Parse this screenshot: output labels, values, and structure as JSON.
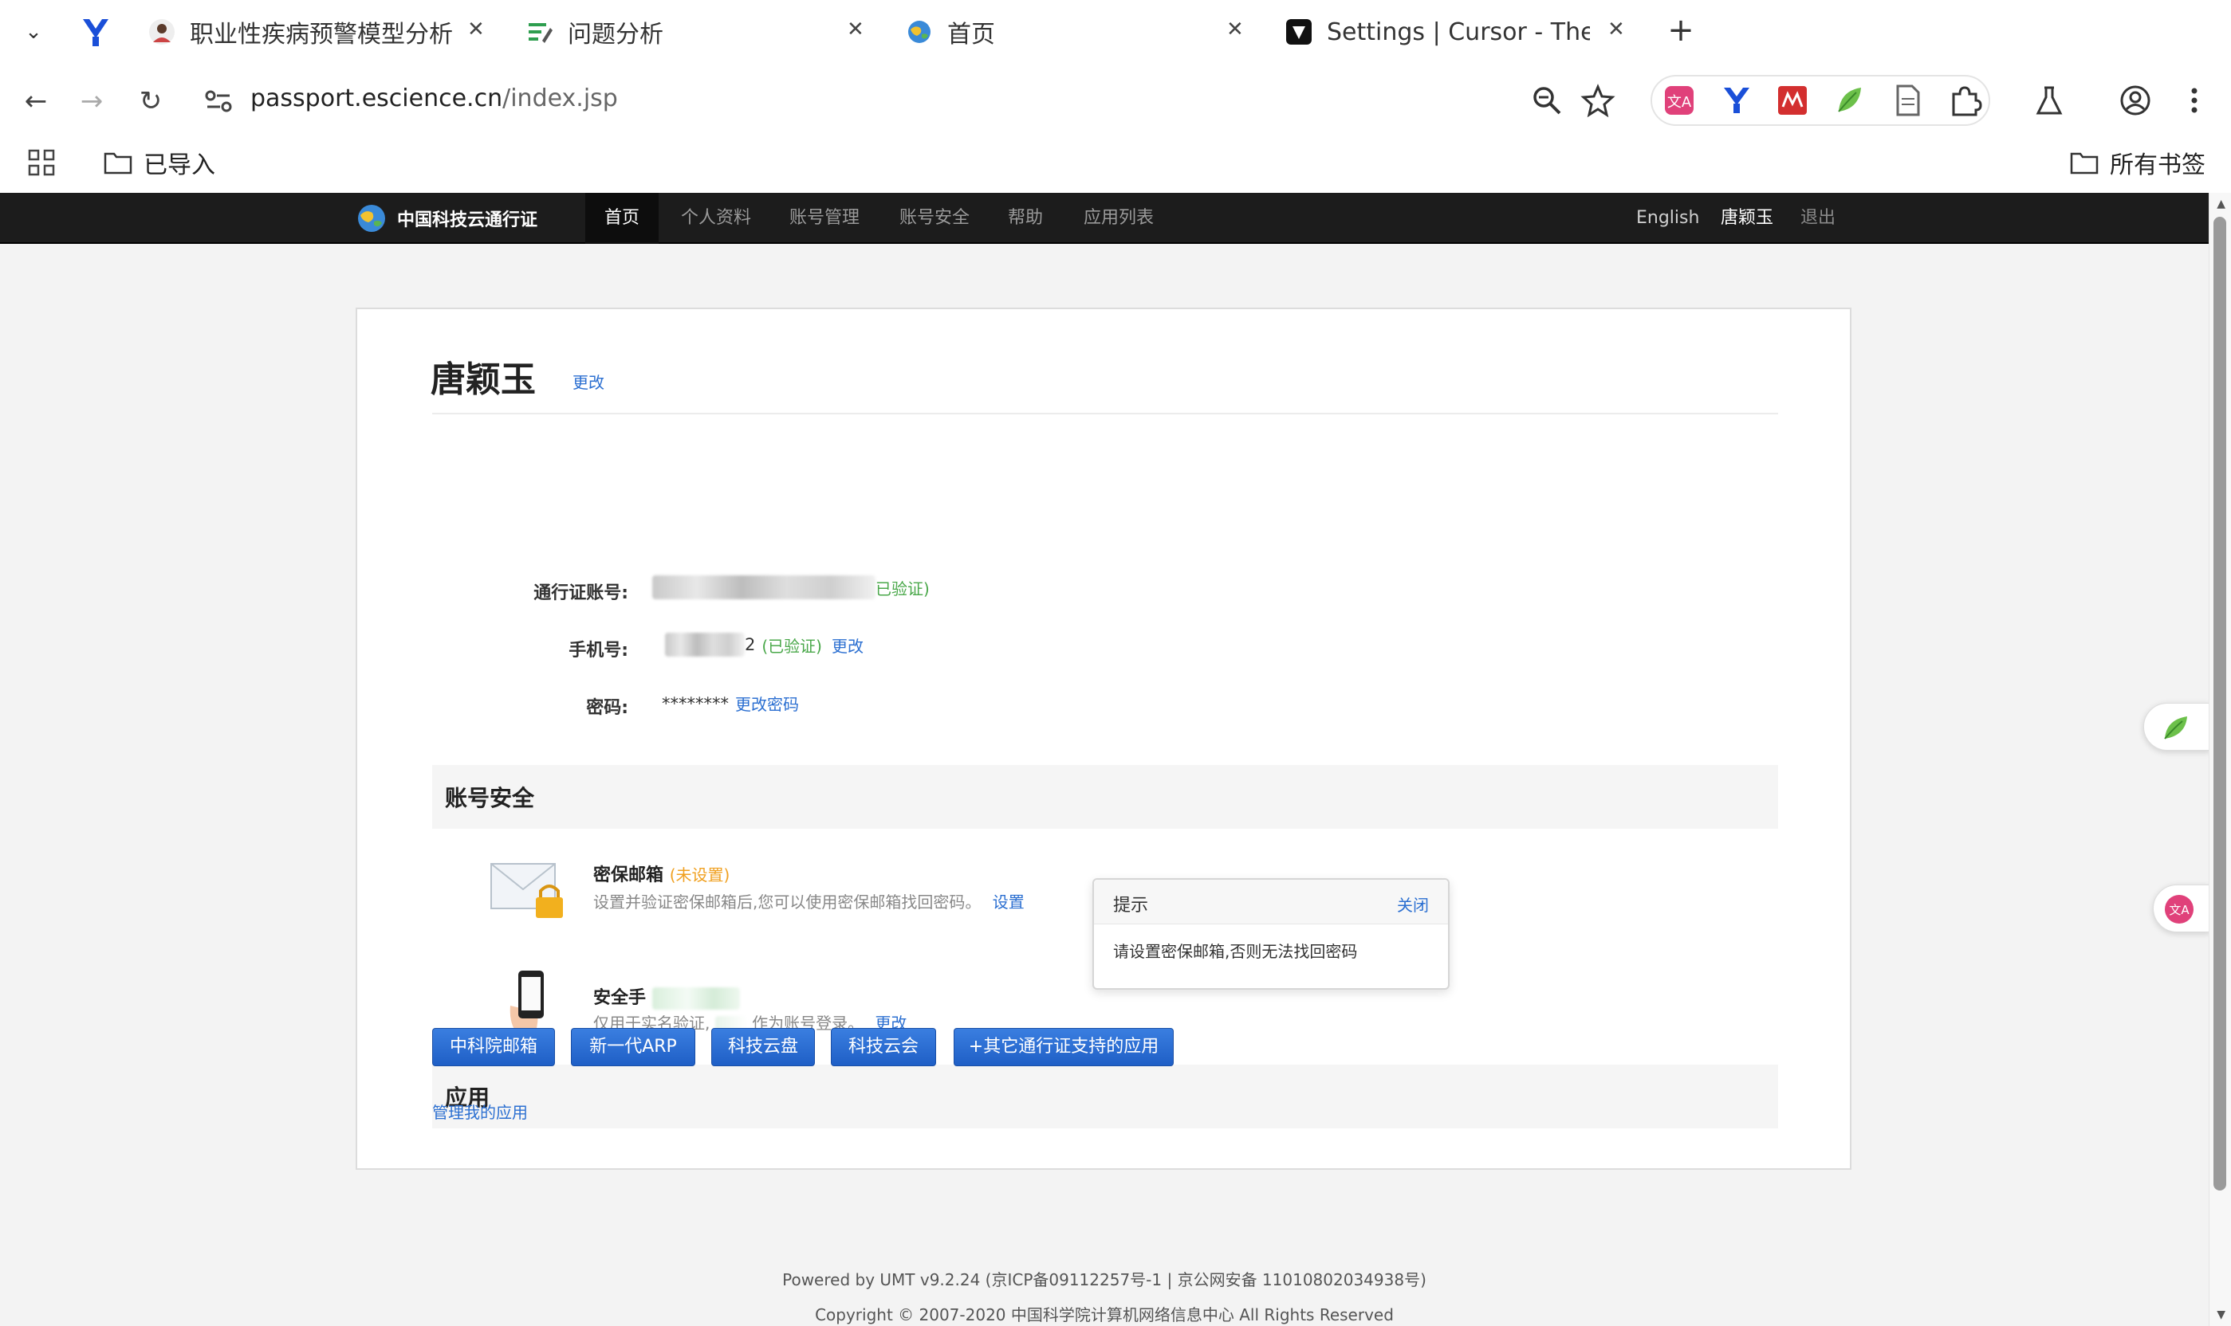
{
  "browser": {
    "tabs": [
      {
        "title": "职业性疾病预警模型分析"
      },
      {
        "title": "问题分析"
      },
      {
        "title": "首页"
      },
      {
        "title": "Settings | Cursor - The AI"
      }
    ],
    "close_glyph": "✕",
    "new_tab_glyph": "+",
    "url_host": "passport.escience.cn",
    "url_path": "/index.jsp",
    "bookmarks": {
      "imported_folder": "已导入",
      "all_bookmarks": "所有书签"
    }
  },
  "site": {
    "brand": "中国科技云通行证",
    "nav": [
      "首页",
      "个人资料",
      "账号管理",
      "账号安全",
      "帮助",
      "应用列表"
    ],
    "nav_right": {
      "english": "English",
      "user": "唐颖玉",
      "logout": "退出"
    }
  },
  "profile": {
    "name": "唐颖玉",
    "change_label": "更改",
    "account_label": "通行证账号:",
    "account_verified_tail": "已验证)",
    "phone_label": "手机号:",
    "phone_tail": "2",
    "phone_verified": "(已验证)",
    "phone_change": "更改",
    "password_label": "密码:",
    "password_mask": "********",
    "password_change": "更改密码"
  },
  "security": {
    "heading": "账号安全",
    "email_title": "密保邮箱",
    "email_status": "(未设置)",
    "email_desc": "设置并验证密保邮箱后,您可以使用密保邮箱找回密码。",
    "email_action": "设置",
    "phone_title": "安全手",
    "phone_desc_a": "仅用于实名验证,",
    "phone_desc_b": "作为账号登录。",
    "phone_action": "更改"
  },
  "tooltip": {
    "title": "提示",
    "close": "关闭",
    "message": "请设置密保邮箱,否则无法找回密码"
  },
  "apps": {
    "heading": "应用",
    "buttons": [
      "中科院邮箱",
      "新一代ARP",
      "科技云盘",
      "科技云会",
      "+其它通行证支持的应用"
    ],
    "manage": "管理我的应用"
  },
  "footer": {
    "line1": "Powered by UMT v9.2.24 (京ICP备09112257号-1 | 京公网安备 11010802034938号)",
    "line2": "Copyright © 2007-2020 中国科学院计算机网络信息中心 All Rights Reserved"
  },
  "colors": {
    "nav_bg": "#1c1c1c",
    "link": "#2b6fd1",
    "verified": "#4aa84a",
    "warning": "#f0a020",
    "button": "#2563c9"
  }
}
